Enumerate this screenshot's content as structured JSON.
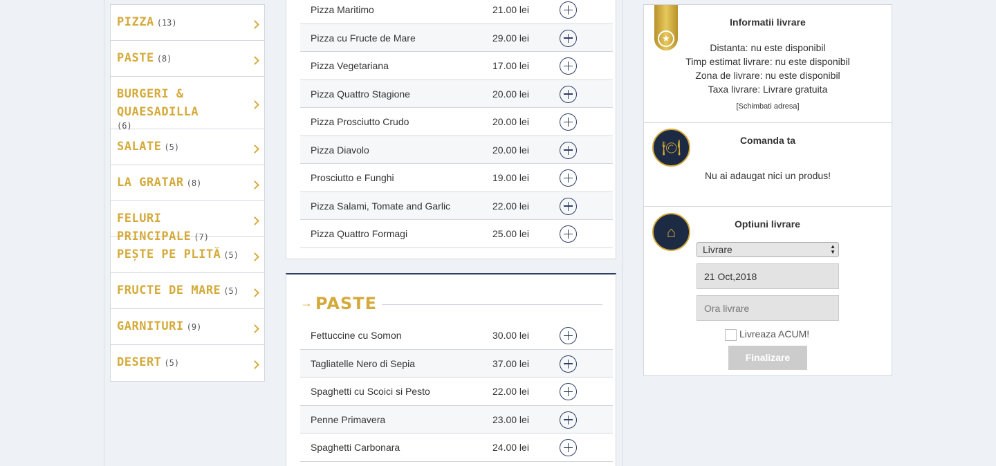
{
  "categories": [
    {
      "name": "PIZZA",
      "count": "(13)"
    },
    {
      "name": "PASTE",
      "count": "(8)"
    },
    {
      "name": "BURGERI & QUAESADILLA",
      "count": "(6)"
    },
    {
      "name": "SALATE",
      "count": "(5)"
    },
    {
      "name": "LA GRATAR",
      "count": "(8)"
    },
    {
      "name": "FELURI PRINCIPALE",
      "count": "(7)"
    },
    {
      "name": "PEȘTE PE PLITĂ",
      "count": "(5)"
    },
    {
      "name": "FRUCTE DE MARE",
      "count": "(5)"
    },
    {
      "name": "GARNITURI",
      "count": "(9)"
    },
    {
      "name": "DESERT",
      "count": "(5)"
    }
  ],
  "pizza_products": [
    {
      "name": "Pizza Maritimo",
      "price": "21.00 lei"
    },
    {
      "name": "Pizza cu Fructe de Mare",
      "price": "29.00 lei"
    },
    {
      "name": "Pizza Vegetariana",
      "price": "17.00 lei"
    },
    {
      "name": "Pizza Quattro Stagione",
      "price": "20.00 lei"
    },
    {
      "name": "Pizza Prosciutto Crudo",
      "price": "20.00 lei"
    },
    {
      "name": "Pizza Diavolo",
      "price": "20.00 lei"
    },
    {
      "name": "Prosciutto e Funghi",
      "price": "19.00 lei"
    },
    {
      "name": "Pizza Salami, Tomate and Garlic",
      "price": "22.00 lei"
    },
    {
      "name": "Pizza Quattro Formagi",
      "price": "25.00 lei"
    }
  ],
  "paste_section": {
    "arrow": "→",
    "title": "PASTE",
    "products": [
      {
        "name": "Fettuccine cu Somon",
        "price": "30.00 lei"
      },
      {
        "name": "Tagliatelle Nero di Sepia",
        "price": "37.00 lei"
      },
      {
        "name": "Spaghetti cu Scoici si Pesto",
        "price": "22.00 lei"
      },
      {
        "name": "Penne Primavera",
        "price": "23.00 lei"
      },
      {
        "name": "Spaghetti Carbonara",
        "price": "24.00 lei"
      }
    ]
  },
  "delivery_info": {
    "title": "Informatii livrare",
    "lines": [
      "Distanta: nu este disponibil",
      "Timp estimat livrare: nu este disponibil",
      "Zona de livrare: nu este disponibil",
      "Taxa livrare: Livrare gratuita"
    ],
    "change_link": "[Schimbati adresa]",
    "icon": "star-ribbon-icon"
  },
  "order": {
    "title": "Comanda ta",
    "empty_text": "Nu ai adaugat nici un produs!",
    "icon": "plate-cutlery-icon"
  },
  "delivery_options": {
    "title": "Optiuni livrare",
    "icon": "delivery-bag-icon",
    "method_selected": "Livrare",
    "date_value": "21 Oct,2018",
    "time_placeholder": "Ora livrare",
    "deliver_now_label": "Livreaza ACUM!",
    "finish_label": "Finalizare"
  },
  "colors": {
    "gold": "#d4aa3a",
    "navy": "#2c3e64",
    "background": "#eef1f5"
  }
}
